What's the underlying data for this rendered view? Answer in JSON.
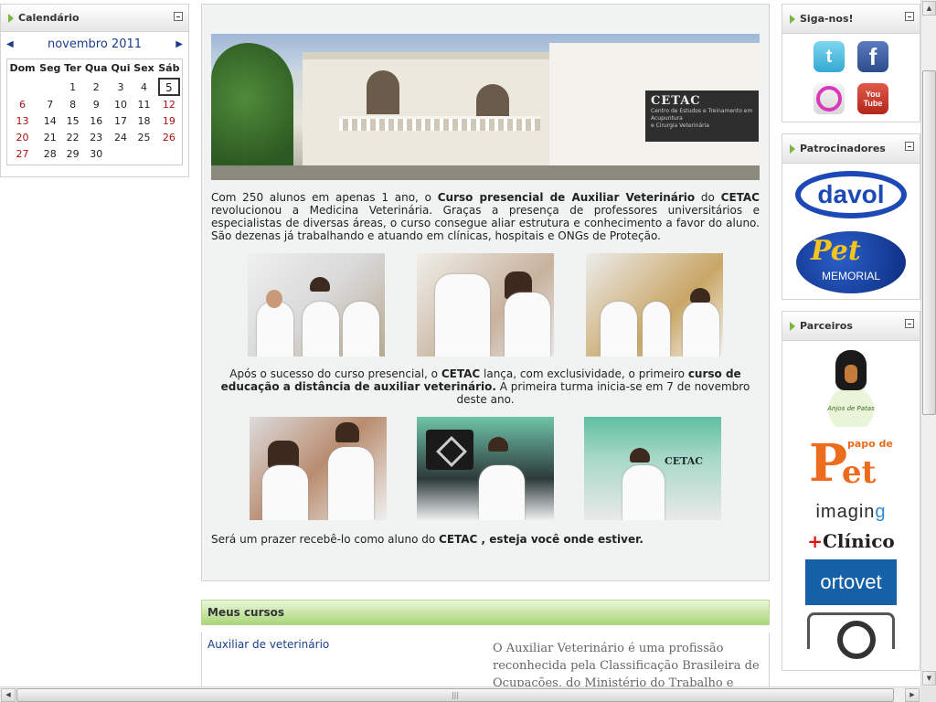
{
  "calendar": {
    "title": "Calendário",
    "month": "novembro 2011",
    "prev": "◀",
    "next": "▶",
    "weekdays": [
      "Dom",
      "Seg",
      "Ter",
      "Qua",
      "Qui",
      "Sex",
      "Sáb"
    ],
    "weeks": [
      [
        "",
        "",
        "1",
        "2",
        "3",
        "4",
        "5"
      ],
      [
        "6",
        "7",
        "8",
        "9",
        "10",
        "11",
        "12"
      ],
      [
        "13",
        "14",
        "15",
        "16",
        "17",
        "18",
        "19"
      ],
      [
        "20",
        "21",
        "22",
        "23",
        "24",
        "25",
        "26"
      ],
      [
        "27",
        "28",
        "29",
        "30",
        "",
        "",
        ""
      ]
    ],
    "today": "5"
  },
  "hero": {
    "sign_name": "CETAC",
    "sign_line1": "Centro de Estudos e Treinamento em Acupuntura",
    "sign_line2": "e Cirurgia Veterinária"
  },
  "content": {
    "para1_a": "Com 250 alunos em apenas 1 ano, o ",
    "para1_b": "Curso presencial de Auxiliar Veterinário",
    "para1_c": " do ",
    "para1_d": "CETAC",
    "para1_e": " revolucionou a Medicina Veterinária. Graças a presença de professores universitários e especialistas de diversas áreas, o curso consegue aliar estrutura e conhecimento a favor do aluno. São dezenas já trabalhando e atuando em clínicas, hospitais e ONGs de Proteção.",
    "para2_a": "Após o sucesso do curso presencial, o ",
    "para2_b": "CETAC",
    "para2_c": " lança, com exclusividade, o primeiro ",
    "para2_d": "curso de educação a distância de auxiliar veterinário.",
    "para2_e": " A primeira turma inicia-se em 7 de novembro deste ano.",
    "para3_a": "Será um prazer recebê-lo como aluno do ",
    "para3_b": "CETAC , esteja você onde estiver.",
    "photo_cetac": "CETAC"
  },
  "courses": {
    "title": "Meus cursos",
    "link": "Auxiliar de veterinário",
    "description": "O Auxiliar Veterinário é uma profissão reconhecida pela Classificação Brasileira de Ocupações, do Ministério do Trabalho e"
  },
  "right": {
    "follow_title": "Siga-nos!",
    "sponsors_title": "Patrocinadores",
    "partners_title": "Parceiros",
    "twitter_glyph": "t",
    "facebook_glyph": "f",
    "youtube_you": "You",
    "youtube_tube": "Tube",
    "davol": "davol",
    "pet_memorial_a": "Pet",
    "pet_memorial_b": "MEMORIAL",
    "anjos": "Anjos de Patas",
    "papo_top": "papo de",
    "papo_p": "P",
    "papo_pet": "et",
    "imagin_a": "imagin",
    "imagin_b": "g",
    "clinico_cross": "+",
    "clinico": "Clínico",
    "ortovet": "ortovet"
  },
  "scroll": {
    "up": "▲",
    "down": "▼",
    "left": "◀",
    "right": "▶",
    "grip": "|||"
  },
  "icons": {
    "collapse": "minus-box-icon",
    "header_bullet": "triangle-bullet-icon"
  },
  "colors": {
    "link": "#1a3e8c",
    "weekend": "#aa1111",
    "courses_header": "#a9d57a"
  }
}
